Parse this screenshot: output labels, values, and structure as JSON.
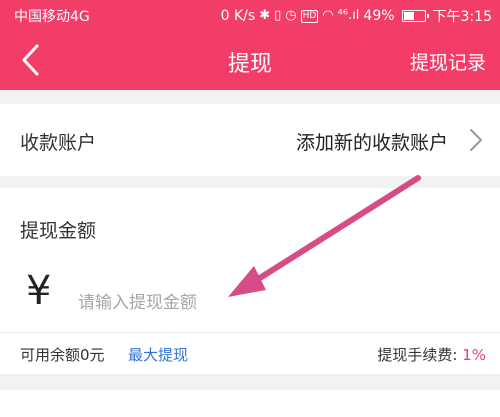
{
  "colors": {
    "brand": "#f23d68",
    "link": "#2f74d4",
    "annotation_arrow": "#d64c86"
  },
  "status_bar": {
    "carrier": "中国移动4G",
    "net_speed": "0 K/s",
    "signal_text": "⁴⁶.ıl",
    "battery": "49%",
    "time": "下午3:15",
    "hd_badge": "HD"
  },
  "nav": {
    "title": "提现",
    "right_action": "提现记录"
  },
  "account": {
    "label": "收款账户",
    "value": "添加新的收款账户"
  },
  "amount": {
    "label": "提现金额",
    "currency": "¥",
    "placeholder": "请输入提现金额",
    "available": "可用余额0元",
    "max_link": "最大提现",
    "fee_label": "提现手续费: ",
    "fee_value": "1%"
  }
}
